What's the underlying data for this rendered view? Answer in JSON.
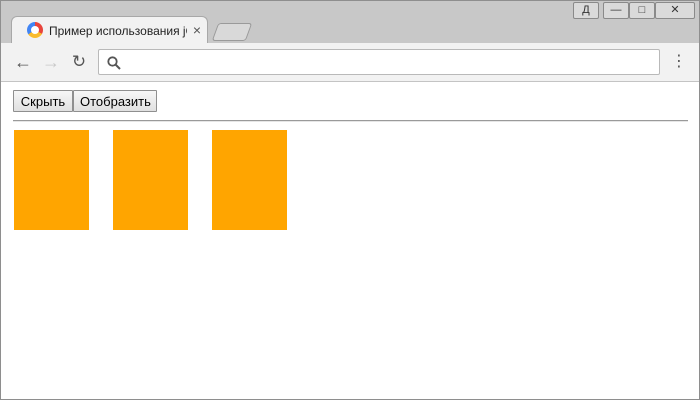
{
  "tab": {
    "title": "Пример использования jQuery"
  },
  "window_controls": {
    "user_label": "Д"
  },
  "address_bar": {
    "value": ""
  },
  "page": {
    "hide_label": "Скрыть",
    "show_label": "Отобразить",
    "box_color": "#ffa500",
    "boxes": [
      {
        "color": "#ffa500"
      },
      {
        "color": "#ffa500"
      },
      {
        "color": "#ffa500"
      }
    ]
  }
}
